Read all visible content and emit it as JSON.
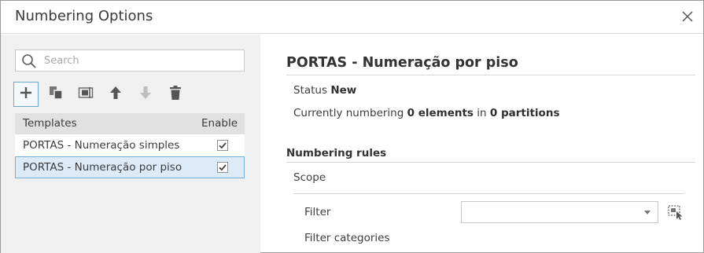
{
  "window": {
    "title": "Numbering Options",
    "close_icon": "close-icon"
  },
  "search": {
    "placeholder": "Search",
    "value": ""
  },
  "toolbar": {
    "buttons": [
      {
        "icon": "add-icon"
      },
      {
        "icon": "duplicate-icon"
      },
      {
        "icon": "rename-icon"
      },
      {
        "icon": "move-up-icon"
      },
      {
        "icon": "move-down-icon"
      },
      {
        "icon": "delete-icon"
      }
    ]
  },
  "templates": {
    "header_name": "Templates",
    "header_enable": "Enable",
    "rows": [
      {
        "name": "PORTAS - Numeração simples",
        "enabled": true,
        "selected": false
      },
      {
        "name": "PORTAS - Numeração por piso",
        "enabled": true,
        "selected": true
      }
    ]
  },
  "detail": {
    "title": "PORTAS - Numeração por piso",
    "status_label": "Status",
    "status_value": "New",
    "numbering_prefix": "Currently numbering",
    "elements_value": "0 elements",
    "in_word": "in",
    "partitions_value": "0 partitions",
    "section_title": "Numbering rules",
    "scope_label": "Scope",
    "filter_label": "Filter",
    "filter_value": "",
    "filter_categories_label": "Filter categories"
  },
  "colors": {
    "accent": "#74b1de",
    "selected_row_bg": "#dcebf7",
    "left_pane_bg": "#f0f0f0",
    "header_bg": "#e1e1e1"
  }
}
